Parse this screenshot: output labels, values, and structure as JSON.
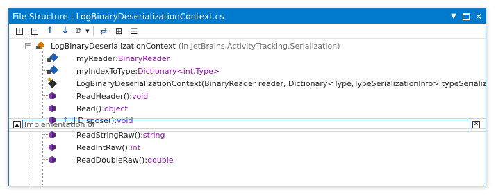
{
  "window": {
    "title": "File Structure - LogBinaryDeserializationContext.cs",
    "controls": [
      "chevron-down-icon",
      "restore-icon",
      "close-icon"
    ]
  },
  "toolbar": {
    "buttons": [
      "expand-all-icon",
      "collapse-all-icon",
      "move-up-icon",
      "move-down-icon",
      "navigate-icon",
      "dropdown-icon",
      "track-caret-icon",
      "region-icon",
      "show-members-icon"
    ]
  },
  "tree": {
    "root": {
      "name": "LogBinaryDeserializationContext",
      "context": "(in JetBrains.ActivityTracking.Serialization)"
    },
    "members": [
      {
        "name": "myReader",
        "sep": ":",
        "type": "BinaryReader",
        "kind": "field"
      },
      {
        "name": "myIndexToType",
        "sep": ":",
        "type": "Dictionary<int,Type>",
        "kind": "field"
      },
      {
        "name": "LogBinaryDeserializationContext(BinaryReader reader, Dictionary<Type,TypeSerializationInfo> typeSerializationInfos)",
        "sep": "",
        "type": "",
        "kind": "ctor"
      },
      {
        "name": "ReadHeader()",
        "sep": ":",
        "type": "void",
        "kind": "method"
      },
      {
        "name": "Read()",
        "sep": ":",
        "type": "object",
        "kind": "method"
      }
    ],
    "after_search": [
      {
        "name": "Dispose()",
        "sep": ":",
        "type": "void",
        "kind": "method"
      },
      {
        "name": "ReadStringRaw()",
        "sep": ":",
        "type": "string",
        "kind": "method"
      },
      {
        "name": "ReadIntRaw()",
        "sep": ":",
        "type": "int",
        "kind": "method"
      },
      {
        "name": "ReadDoubleRaw()",
        "sep": ":",
        "type": "double",
        "kind": "method"
      }
    ]
  },
  "search": {
    "value": "Implementation of"
  }
}
